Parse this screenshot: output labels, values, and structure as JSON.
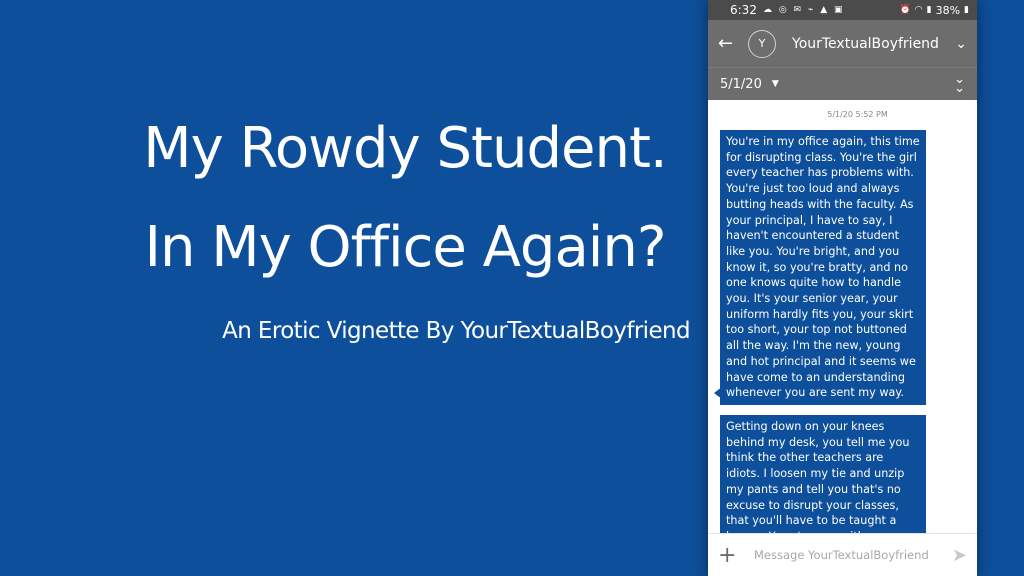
{
  "banner": {
    "title_line1": "My Rowdy Student.",
    "title_line2": "In My Office Again?",
    "subtitle": "An Erotic Vignette By YourTextualBoyfriend"
  },
  "status_bar": {
    "time": "6:32",
    "battery": "38%"
  },
  "app_bar": {
    "avatar_letter": "Y",
    "contact_name": "YourTextualBoyfriend"
  },
  "date_bar": {
    "date": "5/1/20"
  },
  "chat": {
    "timestamp": "5/1/20 5:52 PM",
    "messages": [
      "You're in my office again, this time for disrupting class. You're the girl every teacher has problems with. You're just too loud and always butting heads with the faculty. As your principal, I have to say, I haven't encountered a student like you. You're bright, and you know it, so you're bratty, and no one knows quite how to handle you. It's your senior year, your uniform hardly fits you, your skirt too short, your top not buttoned all the way. I'm the new, young and hot principal and it seems we have come to an understanding whenever you are sent my way.",
      "Getting down on your knees behind my desk, you tell me you think the other teachers are idiots. I loosen my tie and unzip my pants and tell you that's no excuse to disrupt your classes, that you'll have to be taught a lesson. You stare up with"
    ]
  },
  "composer": {
    "placeholder": "Message YourTextualBoyfriend"
  },
  "colors": {
    "background": "#0d4f9a",
    "bubble": "#0d4f9a",
    "toolbar": "#6d6d6d",
    "status_bar": "#4b4b4b"
  },
  "icons": {
    "back": "arrow-left-icon",
    "menu": "chevron-down-icon",
    "date_menu": "caret-down-icon",
    "scroll_bottom": "double-chevron-down-icon",
    "add": "plus-icon",
    "send": "send-icon"
  }
}
